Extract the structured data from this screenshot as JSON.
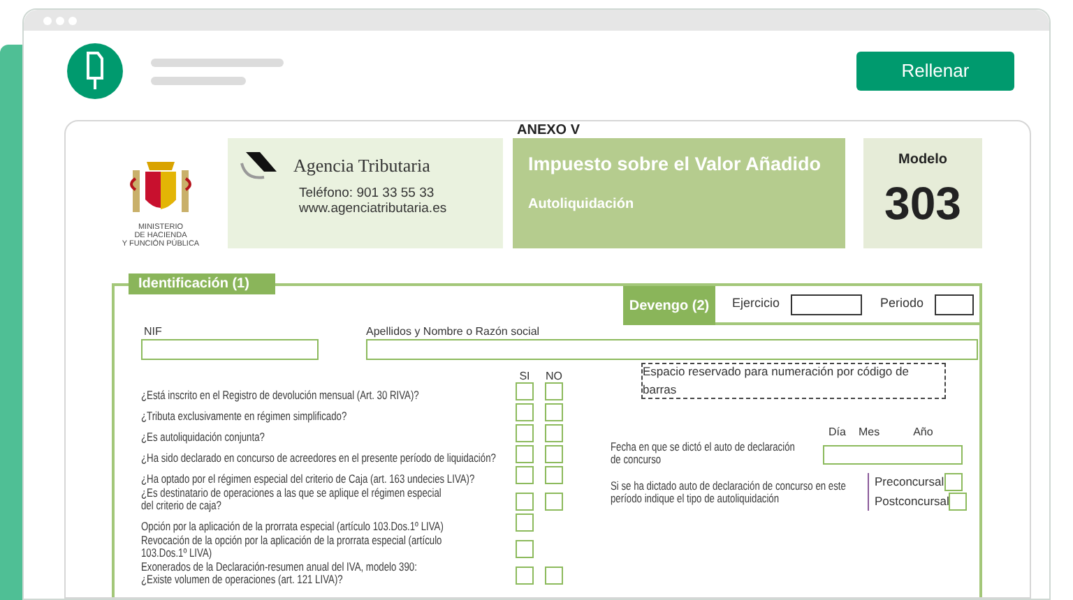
{
  "header": {
    "button": "Rellenar"
  },
  "document": {
    "annex": "ANEXO V",
    "ministry": "MINISTERIO\nDE HACIENDA\nY FUNCIÓN PÚBLICA",
    "agency": "Agencia Tributaria",
    "phone": "Teléfono: 901 33 55 33",
    "web": "www.agenciatributaria.es",
    "tax_title": "Impuesto sobre el Valor Añadido",
    "tax_subtitle": "Autoliquidación",
    "model_label": "Modelo",
    "model_number": "303"
  },
  "section": {
    "title": "Identificación (1)",
    "devengo": "Devengo (2)",
    "ejercicio_label": "Ejercicio",
    "periodo_label": "Periodo",
    "nif_label": "NIF",
    "name_label": "Apellidos y Nombre o Razón social",
    "si_label": "SI",
    "no_label": "NO",
    "questions": [
      {
        "text": "¿Está inscrito en el Registro de devolución mensual (Art. 30 RIVA)?",
        "answers": [
          {
            "checked": false
          },
          {
            "checked": false
          }
        ]
      },
      {
        "text": "¿Tributa exclusivamente en régimen simplificado?",
        "answers": [
          {
            "checked": false
          },
          {
            "checked": false
          }
        ]
      },
      {
        "text": "¿Es autoliquidación conjunta?",
        "answers": [
          {
            "checked": false
          },
          {
            "checked": false
          }
        ]
      },
      {
        "text": "¿Ha sido declarado en concurso de acreedores en el presente período de liquidación?",
        "answers": [
          {
            "checked": false
          },
          {
            "checked": false
          }
        ]
      },
      {
        "text": "¿Ha optado por el régimen especial del criterio de Caja (art. 163 undecies LIVA)?",
        "answers": [
          {
            "checked": false
          },
          {
            "checked": false
          }
        ]
      },
      {
        "text": "¿Es destinatario de operaciones a las que se aplique el régimen especial\ndel criterio de caja?",
        "answers": [
          {
            "checked": false
          },
          {
            "checked": false
          }
        ]
      },
      {
        "text": "Opción por la aplicación de la prorrata especial (artículo 103.Dos.1º LIVA)",
        "answers": [
          {
            "checked": false
          }
        ]
      },
      {
        "text": "Revocación de la opción por la aplicación de la prorrata especial (artículo\n103.Dos.1º LIVA)",
        "answers": [
          {
            "checked": false
          }
        ]
      },
      {
        "text": "Exonerados de la Declaración-resumen anual del IVA, modelo 390:\n¿Existe volumen de operaciones (art. 121 LIVA)?",
        "answers": [
          {
            "checked": false
          },
          {
            "checked": false
          }
        ]
      }
    ],
    "barcode_note": "Espacio reservado para numeración por código de barras",
    "date_headers": [
      "Día",
      "Mes",
      "Año"
    ],
    "date_label": "Fecha en que se dictó el auto de declaración\nde concurso",
    "type_label": "Si se ha dictado auto de declaración de concurso en este\nperíodo indique el tipo de autoliquidación",
    "type_options": [
      {
        "label": "Preconcursal",
        "checked": false
      },
      {
        "label": "Postconcursal",
        "checked": false
      }
    ]
  }
}
